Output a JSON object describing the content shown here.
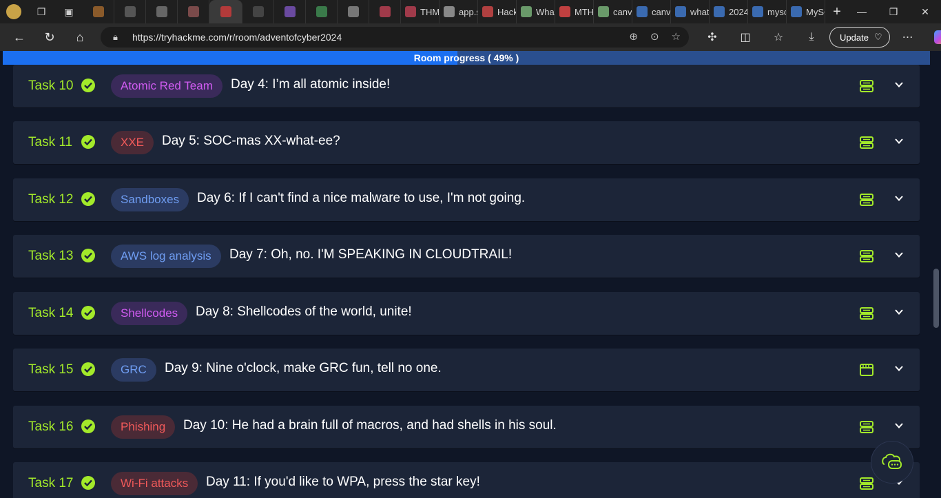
{
  "browser": {
    "tabs": [
      {
        "label": "",
        "color": "#8a5a2a"
      },
      {
        "label": "",
        "color": "#555"
      },
      {
        "label": "",
        "color": "#666"
      },
      {
        "label": "",
        "color": "#7a4a4a"
      },
      {
        "label": "",
        "color": "#b33a3a"
      },
      {
        "label": "",
        "color": "#444"
      },
      {
        "label": "",
        "color": "#6a4aa0"
      },
      {
        "label": "",
        "color": "#3a7a4a"
      },
      {
        "label": "",
        "color": "#777"
      },
      {
        "label": "",
        "color": "#a03a4a"
      },
      {
        "label": "THM",
        "color": "#a03a4a"
      },
      {
        "label": "app.s",
        "color": "#888"
      },
      {
        "label": "Hack",
        "color": "#b04040"
      },
      {
        "label": "What",
        "color": "#6a9a6a"
      },
      {
        "label": "MTH",
        "color": "#c04040"
      },
      {
        "label": "canv",
        "color": "#6a9a6a"
      },
      {
        "label": "canv",
        "color": "#3a6ab0"
      },
      {
        "label": "what",
        "color": "#3a6ab0"
      },
      {
        "label": "2024",
        "color": "#3a6ab0"
      },
      {
        "label": "mysc",
        "color": "#3a6ab0"
      },
      {
        "label": "MySC",
        "color": "#3a6ab0"
      }
    ],
    "url": "https://tryhackme.com/r/room/adventofcyber2024",
    "update_label": "Update"
  },
  "progress": {
    "label": "Room progress ( 49% )",
    "value": 0.49
  },
  "tasks": [
    {
      "label": "Task 10",
      "tag": "Atomic Red Team",
      "tag_style": "purple",
      "title": "Day 4: I’m all atomic inside!",
      "type": "server"
    },
    {
      "label": "Task 11",
      "tag": "XXE",
      "tag_style": "red",
      "title": "Day 5: SOC-mas XX-what-ee?",
      "type": "server"
    },
    {
      "label": "Task 12",
      "tag": "Sandboxes",
      "tag_style": "blue",
      "title": "Day 6: If I can't find a nice malware to use, I'm not going.",
      "type": "server"
    },
    {
      "label": "Task 13",
      "tag": "AWS log analysis",
      "tag_style": "blue",
      "title": "Day 7: Oh, no. I'M SPEAKING IN CLOUDTRAIL!",
      "type": "server"
    },
    {
      "label": "Task 14",
      "tag": "Shellcodes",
      "tag_style": "purple",
      "title": "Day 8: Shellcodes of the world, unite!",
      "type": "server"
    },
    {
      "label": "Task 15",
      "tag": "GRC",
      "tag_style": "blue",
      "title": "Day 9: Nine o'clock, make GRC fun, tell no one.",
      "type": "browser"
    },
    {
      "label": "Task 16",
      "tag": "Phishing",
      "tag_style": "red",
      "title": "Day 10: He had a brain full of macros, and had shells in his soul.",
      "type": "server"
    },
    {
      "label": "Task 17",
      "tag": "Wi-Fi attacks",
      "tag_style": "red",
      "title": "Day 11: If you'd like to WPA, press the star key!",
      "type": "server"
    }
  ]
}
